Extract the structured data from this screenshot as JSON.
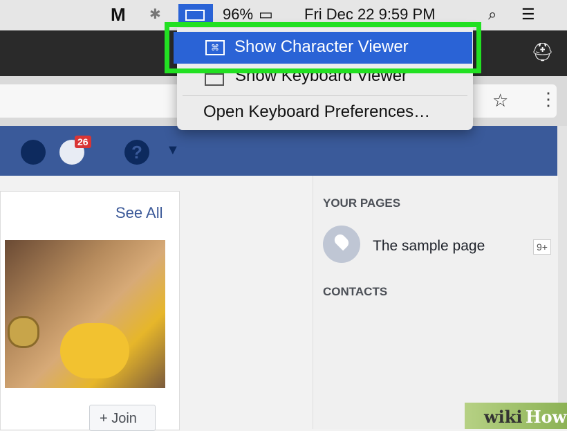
{
  "menubar": {
    "battery": "96%",
    "datetime": "Fri Dec 22  9:59 PM"
  },
  "menu": {
    "items": [
      {
        "label": "Show Character Viewer",
        "highlighted": true
      },
      {
        "label": "Show Keyboard Viewer",
        "highlighted": false
      },
      {
        "label": "Open Keyboard Preferences…",
        "highlighted": false
      }
    ]
  },
  "facebook": {
    "notifications_badge": "26",
    "see_all": "See All",
    "join_label": "+ Join",
    "your_pages_heading": "YOUR PAGES",
    "page_name": "The sample page",
    "page_badge": "9+",
    "contacts_heading": "CONTACTS"
  },
  "watermark": {
    "text1": "wiki",
    "text2": "How"
  },
  "colors": {
    "highlight": "#2a63d6",
    "outline": "#22e022",
    "fb_blue": "#3a5a9a"
  }
}
